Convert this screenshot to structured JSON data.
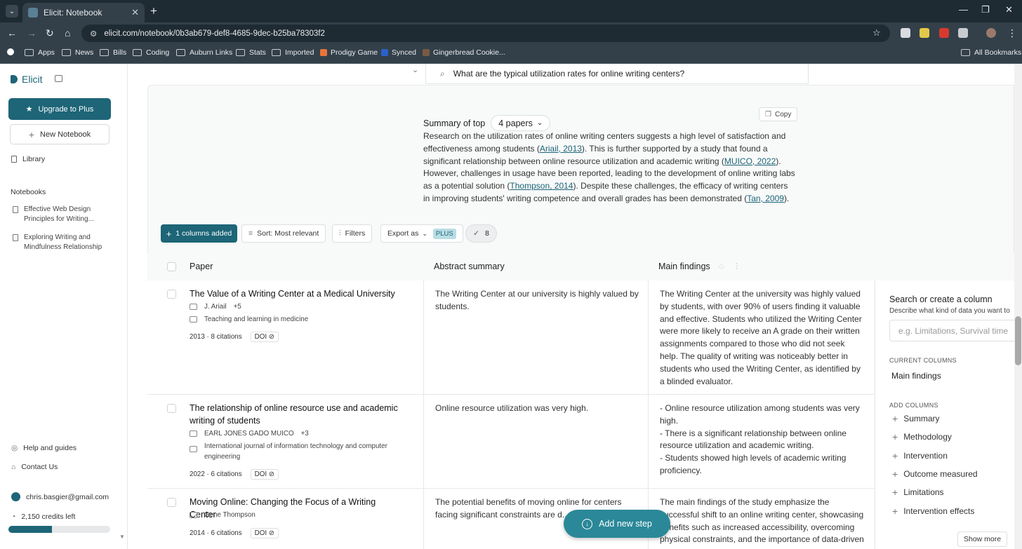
{
  "browser": {
    "tab_title": "Elicit: Notebook",
    "url": "elicit.com/notebook/0b3ab679-def8-4685-9dec-b25ba78303f2",
    "bookmarks": [
      "Apps",
      "News",
      "Bills",
      "Coding",
      "Auburn Links",
      "Stats",
      "Imported",
      "Prodigy Game",
      "Synced",
      "Gingerbread Cookie..."
    ],
    "all_bookmarks": "All Bookmarks"
  },
  "sidebar": {
    "brand": "Elicit",
    "upgrade_label": "Upgrade to Plus",
    "new_notebook_label": "New Notebook",
    "library_label": "Library",
    "notebooks_heading": "Notebooks",
    "notebooks": [
      "Effective Web Design Principles for Writing...",
      "Exploring Writing and Mindfulness Relationship"
    ],
    "help_label": "Help and guides",
    "contact_label": "Contact Us",
    "user_email": "chris.basgier@gmail.com",
    "credits": "2,150 credits left",
    "credits_fraction": 0.43
  },
  "main": {
    "query": "What are the typical utilization rates for online writing centers?",
    "summary_prefix": "Summary of top",
    "papers_select": "4 papers",
    "copy_label": "Copy",
    "summary": {
      "t1": "Research on the utilization rates of online writing centers suggests a high level of satisfaction and effectiveness among students (",
      "c1": "Ariail, 2013",
      "t2": "). This is further supported by a study that found a significant relationship between online resource utilization and academic writing (",
      "c2": "MUICO, 2022",
      "t3": "). However, challenges in usage have been reported, leading to the development of online writing labs as a potential solution (",
      "c3": "Thompson, 2014",
      "t4": "). Despite these challenges, the efficacy of writing centers in improving students' writing competence and overall grades has been demonstrated (",
      "c4": "Tan, 2009",
      "t5": ")."
    },
    "toolbar": {
      "columns_added": "1 columns added",
      "sort": "Sort: Most relevant",
      "filters": "Filters",
      "export": "Export as",
      "plus_badge": "PLUS",
      "check_count": "8"
    },
    "columns": {
      "paper": "Paper",
      "abstract": "Abstract summary",
      "findings": "Main findings"
    },
    "rows": [
      {
        "title": "The Value of a Writing Center at a Medical University",
        "authors": "J. Ariail",
        "more": "+5",
        "journal": "Teaching and learning in medicine",
        "year_cites": "2013 · 8 citations",
        "doi": "DOI",
        "abstract": "The Writing Center at our university is highly valued by students.",
        "findings": "The Writing Center at the university was highly valued by students, with over 90% of users finding it valuable and effective. Students who utilized the Writing Center were more likely to receive an A grade on their written assignments compared to those who did not seek help. The quality of writing was noticeably better in students who used the Writing Center, as identified by a blinded evaluator."
      },
      {
        "title": "The relationship of online resource use and academic writing of students",
        "authors": "EARL JONES GADO MUICO",
        "more": "+3",
        "journal": "International journal of information technology and computer engineering",
        "year_cites": "2022 · 6 citations",
        "doi": "DOI",
        "abstract": "Online resource utilization was very high.",
        "findings": "- Online resource utilization among students was very high.\n- There is a significant relationship between online resource utilization and academic writing.\n- Students showed high levels of academic writing proficiency."
      },
      {
        "title": "Moving Online: Changing the Focus of a Writing Center",
        "authors": "Gene Thompson",
        "more": "",
        "journal": "",
        "year_cites": "2014 · 6 citations",
        "doi": "DOI",
        "abstract": "The potential benefits of moving online for centers facing significant constraints are d...",
        "findings": "The main findings of the study emphasize the successful shift to an online writing center, showcasing benefits such as increased accessibility, overcoming physical constraints, and the importance of data-driven"
      }
    ],
    "add_step_label": "Add new step"
  },
  "column_panel": {
    "title": "Search or create a column",
    "description": "Describe what kind of data you want to",
    "placeholder": "e.g. Limitations, Survival time",
    "current_heading": "CURRENT COLUMNS",
    "current_columns": [
      "Main findings"
    ],
    "add_heading": "ADD COLUMNS",
    "add_columns": [
      "Summary",
      "Methodology",
      "Intervention",
      "Outcome measured",
      "Limitations",
      "Intervention effects"
    ],
    "show_more": "Show more"
  }
}
